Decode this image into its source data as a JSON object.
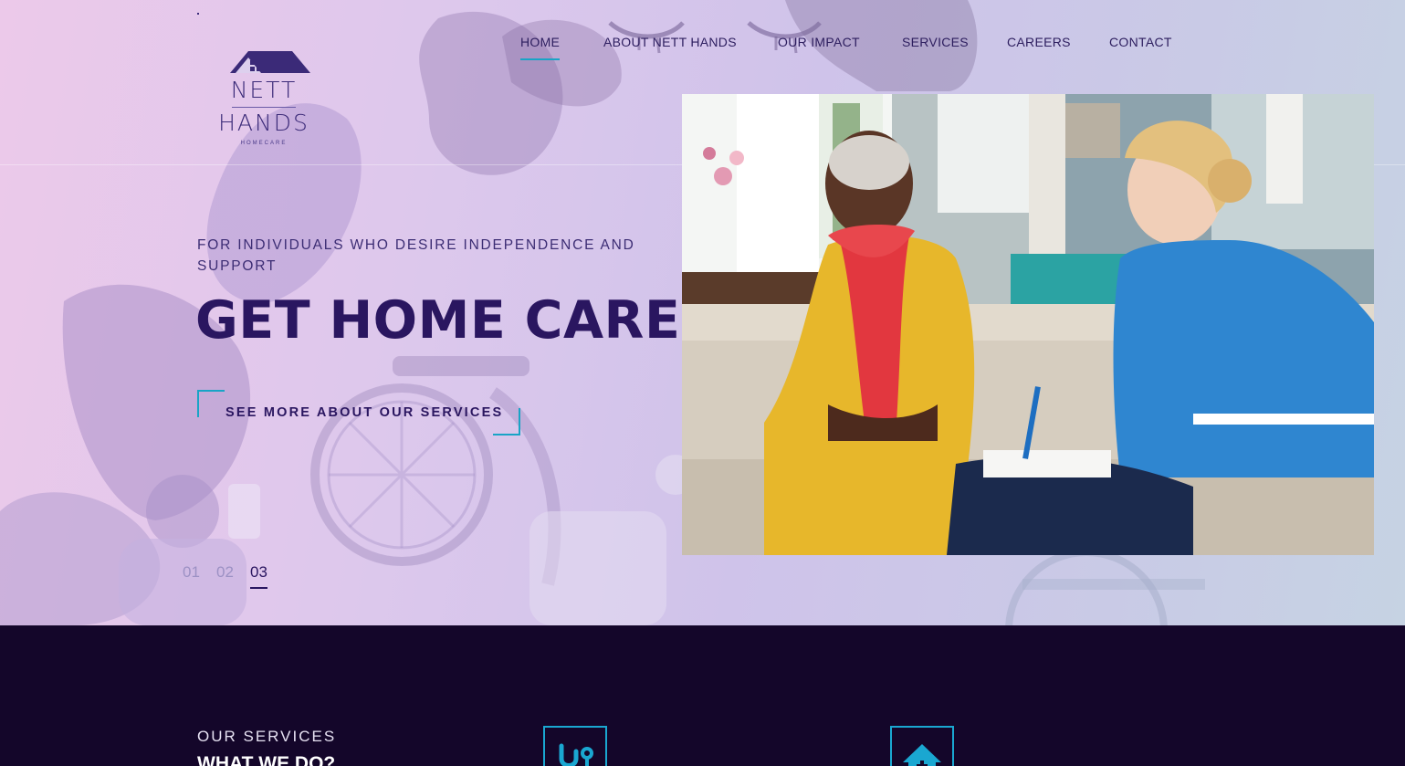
{
  "brand": {
    "name_top": "NETT",
    "name_bottom": "HANDS",
    "subtitle": "HOMECARE"
  },
  "nav": {
    "items": [
      {
        "label": "HOME",
        "active": true
      },
      {
        "label": "ABOUT NETT HANDS",
        "active": false
      },
      {
        "label": "OUR IMPACT",
        "active": false
      },
      {
        "label": "SERVICES",
        "active": false
      },
      {
        "label": "CAREERS",
        "active": false
      },
      {
        "label": "CONTACT",
        "active": false
      }
    ]
  },
  "hero": {
    "tagline": "FOR INDIVIDUALS WHO DESIRE INDEPENDENCE AND SUPPORT",
    "headline": "GET HOME CARE",
    "cta_label": "SEE MORE ABOUT OUR SERVICES",
    "slides": [
      "01",
      "02",
      "03"
    ],
    "active_slide": "03"
  },
  "services": {
    "overline": "OUR SERVICES",
    "title": "WHAT WE DO?",
    "cards": [
      {
        "icon": "stethoscope-icon"
      },
      {
        "icon": "home-medical-icon"
      }
    ]
  },
  "colors": {
    "primary": "#2a1660",
    "accent": "#19a4c6",
    "dark_bg": "#14062a"
  }
}
